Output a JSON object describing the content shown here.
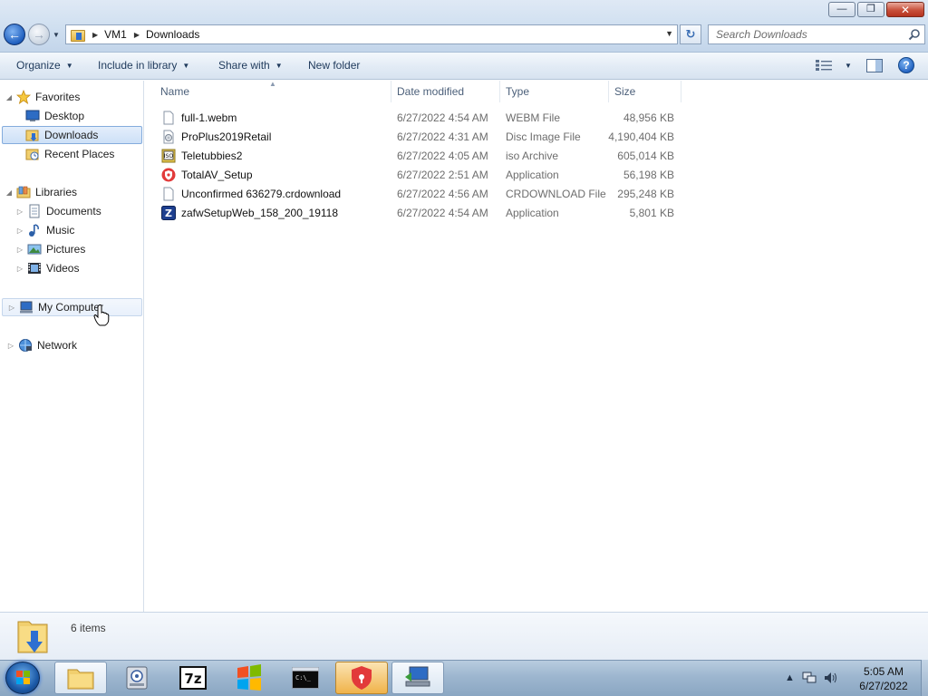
{
  "window": {
    "controls": {
      "minimize": "minimize",
      "maximize": "maximize",
      "close": "close"
    }
  },
  "address": {
    "crumbs": [
      "VM1",
      "Downloads"
    ],
    "search_placeholder": "Search Downloads"
  },
  "toolbar": {
    "organize": "Organize",
    "include_in_library": "Include in library",
    "share_with": "Share with",
    "new_folder": "New folder"
  },
  "nav": {
    "favorites": "Favorites",
    "desktop": "Desktop",
    "downloads": "Downloads",
    "recent_places": "Recent Places",
    "libraries": "Libraries",
    "documents": "Documents",
    "music": "Music",
    "pictures": "Pictures",
    "videos": "Videos",
    "my_computer": "My Computer",
    "network": "Network",
    "selected": "Downloads"
  },
  "columns": {
    "name": "Name",
    "date_modified": "Date modified",
    "type": "Type",
    "size": "Size"
  },
  "files": [
    {
      "name": "full-1.webm",
      "date": "6/27/2022 4:54 AM",
      "type": "WEBM File",
      "size": "48,956 KB",
      "icon": "blank-file-icon"
    },
    {
      "name": "ProPlus2019Retail",
      "date": "6/27/2022 4:31 AM",
      "type": "Disc Image File",
      "size": "4,190,404 KB",
      "icon": "disc-image-icon"
    },
    {
      "name": "Teletubbies2",
      "date": "6/27/2022 4:05 AM",
      "type": "iso Archive",
      "size": "605,014 KB",
      "icon": "iso-archive-icon"
    },
    {
      "name": "TotalAV_Setup",
      "date": "6/27/2022 2:51 AM",
      "type": "Application",
      "size": "56,198 KB",
      "icon": "shield-app-icon"
    },
    {
      "name": "Unconfirmed 636279.crdownload",
      "date": "6/27/2022 4:56 AM",
      "type": "CRDOWNLOAD File",
      "size": "295,248 KB",
      "icon": "blank-file-icon"
    },
    {
      "name": "zafwSetupWeb_158_200_19118",
      "date": "6/27/2022 4:54 AM",
      "type": "Application",
      "size": "5,801 KB",
      "icon": "zonealarm-app-icon"
    }
  ],
  "details": {
    "count": "6 items"
  },
  "taskbar": {
    "apps": [
      "windows-explorer-icon",
      "disk-utility-icon",
      "7zip-icon",
      "windows-flag-icon",
      "command-prompt-icon",
      "totalav-shield-icon",
      "remote-computer-icon"
    ],
    "clock_time": "5:05 AM",
    "clock_date": "6/27/2022"
  },
  "colors": {
    "accent": "#1f5fbf",
    "selection": "#cde0f7",
    "muted_text": "#6d6d6d"
  }
}
